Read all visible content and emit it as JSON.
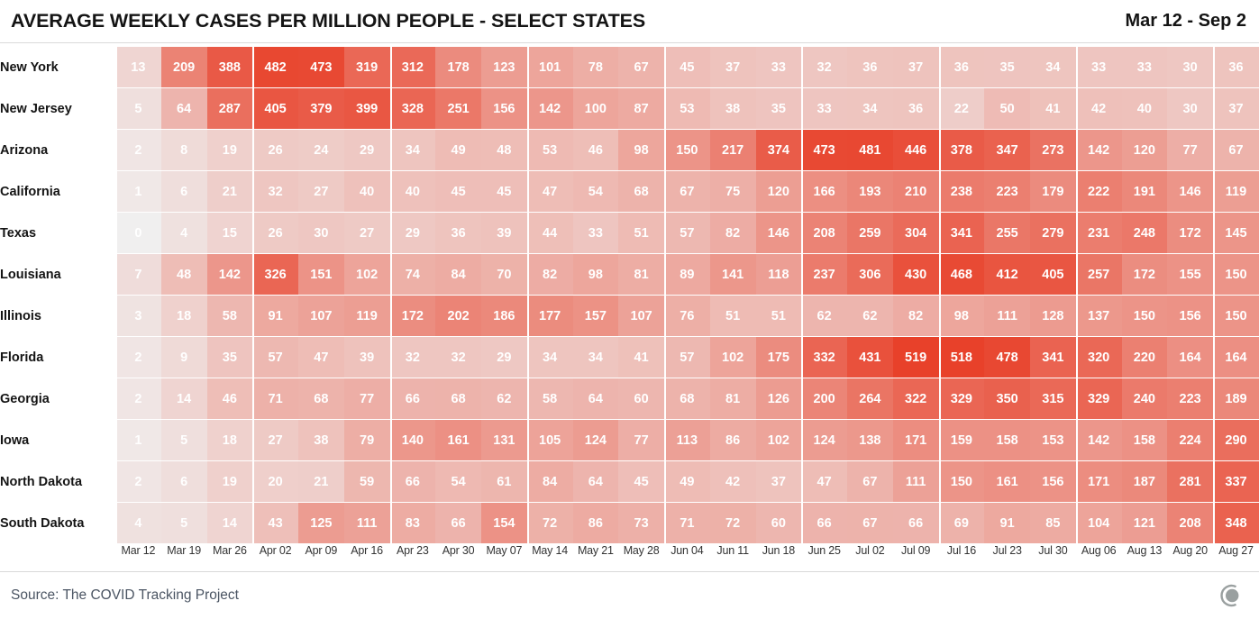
{
  "header": {
    "title": "AVERAGE WEEKLY CASES PER MILLION PEOPLE - SELECT STATES",
    "date_range": "Mar 12 - Sep 2"
  },
  "footer": {
    "source": "Source: The COVID Tracking Project",
    "logo_name": "circle-logo"
  },
  "colors": {
    "max": "#e8412a",
    "min": "#f0efef",
    "text_on_cell": "#ffffff",
    "title": "#141414",
    "source_text": "#4b5563",
    "rule": "#d9d9d9"
  },
  "chart_data": {
    "type": "heatmap",
    "title": "AVERAGE WEEKLY CASES PER MILLION PEOPLE - SELECT STATES",
    "subtitle": "Mar 12 - Sep 2",
    "xlabel": "",
    "ylabel": "",
    "legend": "none",
    "grid": false,
    "colorscale": {
      "low": "#f0efef",
      "high": "#e8412a",
      "vmin": 0,
      "vmax": 519
    },
    "categories": [
      "Mar 12",
      "Mar 19",
      "Mar 26",
      "Apr 02",
      "Apr 09",
      "Apr 16",
      "Apr 23",
      "Apr 30",
      "May 07",
      "May 14",
      "May 21",
      "May 28",
      "Jun 04",
      "Jun 11",
      "Jun 18",
      "Jun 25",
      "Jul 02",
      "Jul 09",
      "Jul 16",
      "Jul 23",
      "Jul 30",
      "Aug 06",
      "Aug 13",
      "Aug 20",
      "Aug 27"
    ],
    "rows": [
      "New York",
      "New Jersey",
      "Arizona",
      "California",
      "Texas",
      "Louisiana",
      "Illinois",
      "Florida",
      "Georgia",
      "Iowa",
      "North Dakota",
      "South Dakota"
    ],
    "series": [
      {
        "name": "New York",
        "values": [
          13,
          209,
          388,
          482,
          473,
          319,
          312,
          178,
          123,
          101,
          78,
          67,
          45,
          37,
          33,
          32,
          36,
          37,
          36,
          35,
          34,
          33,
          33,
          30,
          36
        ]
      },
      {
        "name": "New Jersey",
        "values": [
          5,
          64,
          287,
          405,
          379,
          399,
          328,
          251,
          156,
          142,
          100,
          87,
          53,
          38,
          35,
          33,
          34,
          36,
          22,
          50,
          41,
          42,
          40,
          30,
          37
        ]
      },
      {
        "name": "Arizona",
        "values": [
          2,
          8,
          19,
          26,
          24,
          29,
          34,
          49,
          48,
          53,
          46,
          98,
          150,
          217,
          374,
          473,
          481,
          446,
          378,
          347,
          273,
          142,
          120,
          77,
          67
        ]
      },
      {
        "name": "California",
        "values": [
          1,
          6,
          21,
          32,
          27,
          40,
          40,
          45,
          45,
          47,
          54,
          68,
          67,
          75,
          120,
          166,
          193,
          210,
          238,
          223,
          179,
          222,
          191,
          146,
          119
        ]
      },
      {
        "name": "Texas",
        "values": [
          0,
          4,
          15,
          26,
          30,
          27,
          29,
          36,
          39,
          44,
          33,
          51,
          57,
          82,
          146,
          208,
          259,
          304,
          341,
          255,
          279,
          231,
          248,
          172,
          145
        ]
      },
      {
        "name": "Louisiana",
        "values": [
          7,
          48,
          142,
          326,
          151,
          102,
          74,
          84,
          70,
          82,
          98,
          81,
          89,
          141,
          118,
          237,
          306,
          430,
          468,
          412,
          405,
          257,
          172,
          155,
          150
        ]
      },
      {
        "name": "Illinois",
        "values": [
          3,
          18,
          58,
          91,
          107,
          119,
          172,
          202,
          186,
          177,
          157,
          107,
          76,
          51,
          51,
          62,
          62,
          82,
          98,
          111,
          128,
          137,
          150,
          156,
          150
        ]
      },
      {
        "name": "Florida",
        "values": [
          2,
          9,
          35,
          57,
          47,
          39,
          32,
          32,
          29,
          34,
          34,
          41,
          57,
          102,
          175,
          332,
          431,
          519,
          518,
          478,
          341,
          320,
          220,
          164,
          164
        ]
      },
      {
        "name": "Georgia",
        "values": [
          2,
          14,
          46,
          71,
          68,
          77,
          66,
          68,
          62,
          58,
          64,
          60,
          68,
          81,
          126,
          200,
          264,
          322,
          329,
          350,
          315,
          329,
          240,
          223,
          189
        ]
      },
      {
        "name": "Iowa",
        "values": [
          1,
          5,
          18,
          27,
          38,
          79,
          140,
          161,
          131,
          105,
          124,
          77,
          113,
          86,
          102,
          124,
          138,
          171,
          159,
          158,
          153,
          142,
          158,
          224,
          290
        ]
      },
      {
        "name": "North Dakota",
        "values": [
          2,
          6,
          19,
          20,
          21,
          59,
          66,
          54,
          61,
          84,
          64,
          45,
          49,
          42,
          37,
          47,
          67,
          111,
          150,
          161,
          156,
          171,
          187,
          281,
          337
        ]
      },
      {
        "name": "South Dakota",
        "values": [
          4,
          5,
          14,
          43,
          125,
          111,
          83,
          66,
          154,
          72,
          86,
          73,
          71,
          72,
          60,
          66,
          67,
          66,
          69,
          91,
          85,
          104,
          121,
          208,
          348
        ]
      }
    ]
  }
}
